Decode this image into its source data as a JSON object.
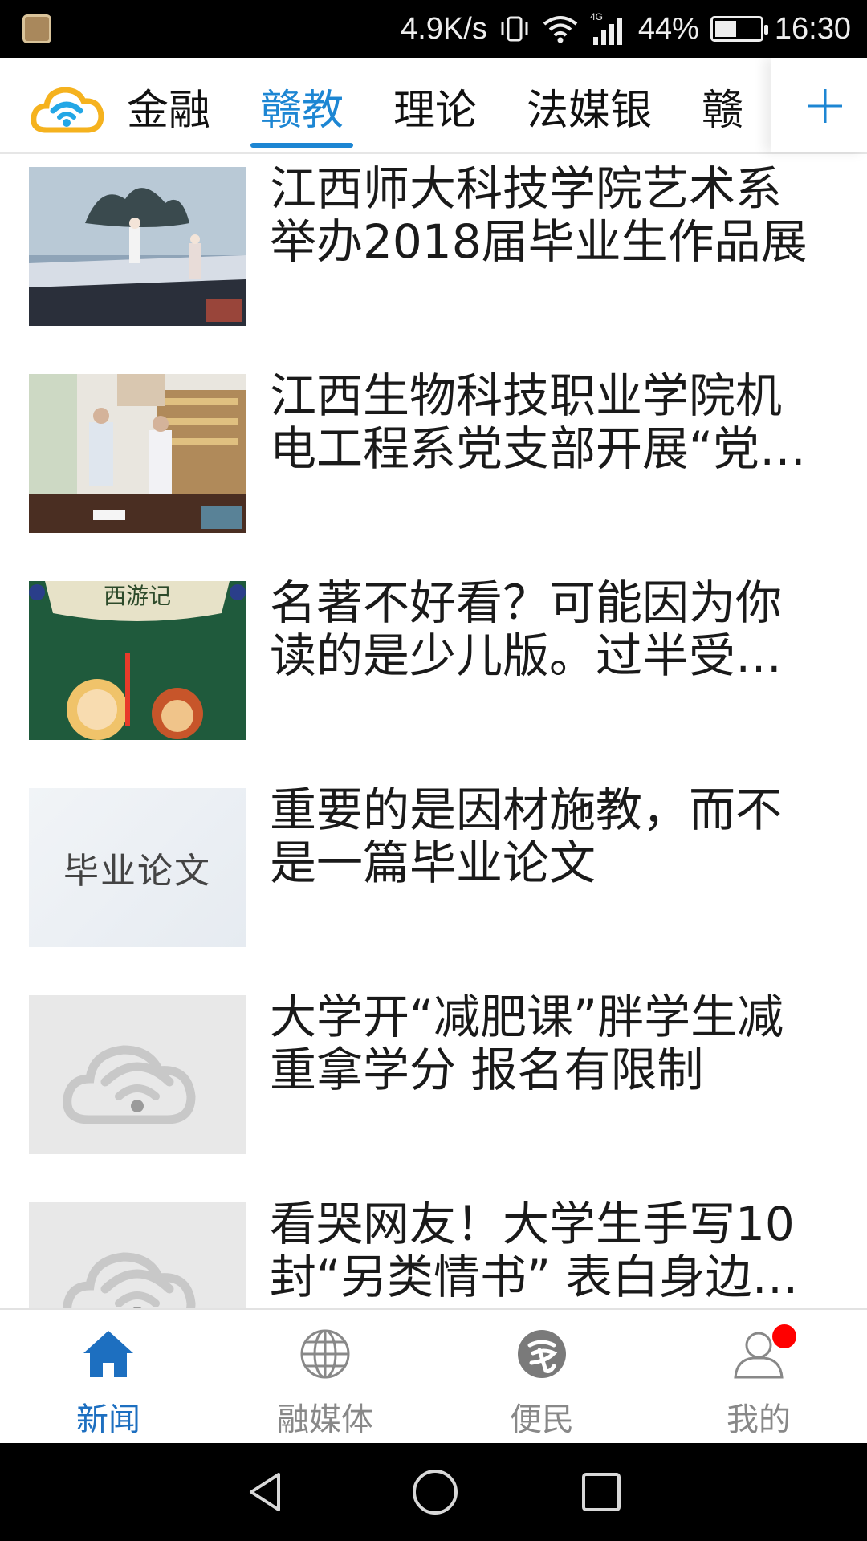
{
  "status": {
    "speed": "4.9K/s",
    "network": "4G",
    "battery": "44%",
    "battery_level": 0.44,
    "time": "16:30"
  },
  "nav": {
    "logo_icon": "cloud-wifi-logo",
    "tabs": [
      {
        "label": "金融",
        "active": false
      },
      {
        "label": "赣教",
        "active": true
      },
      {
        "label": "理论",
        "active": false
      },
      {
        "label": "法媒银",
        "active": false
      },
      {
        "label": "赣",
        "active": false
      }
    ],
    "add_icon": "plus-icon",
    "accent": "#1d86d3"
  },
  "news": [
    {
      "title": "江西师大科技学院艺术系举办2018届毕业生作品展",
      "thumb": "stage-performance"
    },
    {
      "title": "江西生物科技职业学院机电工程系党支部开展“党…",
      "thumb": "office-meeting"
    },
    {
      "title": "名著不好看？可能因为你读的是少儿版。过半受…",
      "thumb": "journey-to-west",
      "thumb_text": "西游记"
    },
    {
      "title": "重要的是因材施教，而不是一篇毕业论文",
      "thumb": "thesis-card",
      "thumb_text": "毕业论文"
    },
    {
      "title": "大学开“减肥课”胖学生减重拿学分 报名有限制",
      "thumb": "placeholder-logo"
    },
    {
      "title": "看哭网友！大学生手写10封“另类情书” 表白身边…",
      "thumb": "placeholder-logo"
    }
  ],
  "bottom": {
    "items": [
      {
        "label": "新闻",
        "icon": "home-icon",
        "active": true
      },
      {
        "label": "融媒体",
        "icon": "globe-icon",
        "active": false
      },
      {
        "label": "便民",
        "icon": "service-icon",
        "active": false
      },
      {
        "label": "我的",
        "icon": "user-icon",
        "active": false,
        "badge": true
      }
    ],
    "active_color": "#1d6fc0",
    "badge_color": "#ff0000"
  },
  "system_nav": [
    "back-icon",
    "home-circle-icon",
    "recents-icon"
  ]
}
